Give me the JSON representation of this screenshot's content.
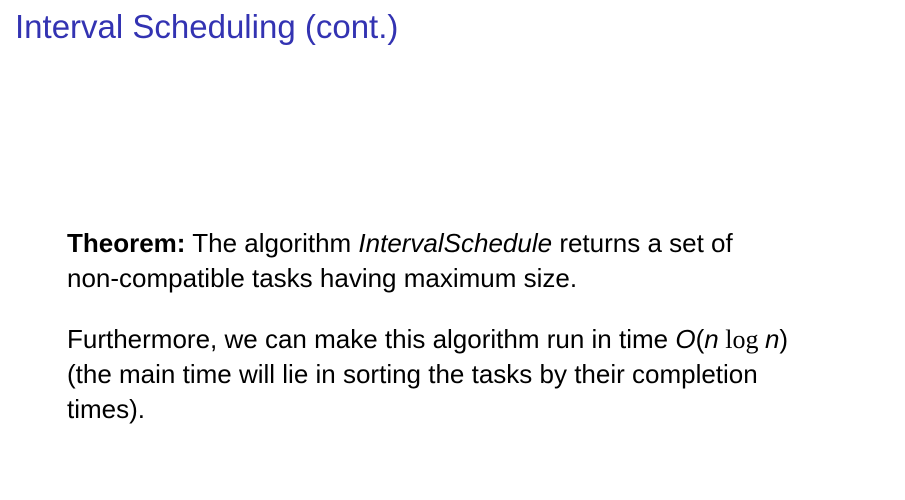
{
  "slide": {
    "title": "Interval Scheduling (cont.)",
    "theorem": {
      "label": "Theorem:",
      "text_before": " The algorithm ",
      "algorithm_name": "IntervalSchedule",
      "text_after_line1": " returns a set of",
      "line2": "non-compatible tasks having maximum size."
    },
    "furthermore": {
      "text_before": "Furthermore, we can make this algorithm run in time ",
      "complexity_O": "O",
      "paren_open": "(",
      "var_n1": "n",
      "log_word": " log ",
      "var_n2": "n",
      "paren_close": ")",
      "line2": "(the main time will lie in sorting the tasks by their completion",
      "line3": "times)."
    }
  },
  "colors": {
    "title": "#3333b2",
    "text": "#000000",
    "background": "#ffffff"
  }
}
